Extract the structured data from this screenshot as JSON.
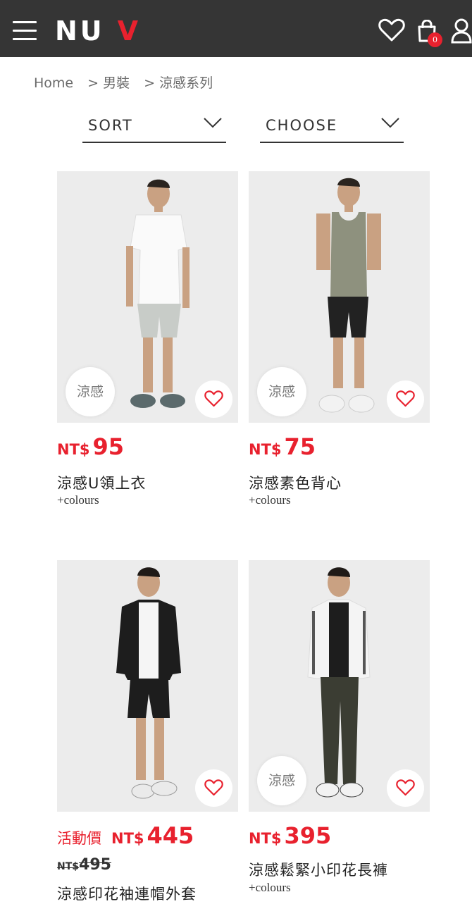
{
  "header": {
    "logo_left": "NU",
    "logo_right": "V",
    "cart_count": "0",
    "brand_color": "#e8212e",
    "bg_color": "#353535"
  },
  "breadcrumb": [
    "Home",
    "> 男裝",
    "> 涼感系列"
  ],
  "filters": {
    "sort_label": "SORT",
    "choose_label": "CHOOSE"
  },
  "products": [
    {
      "badge": "涼感",
      "currency": "NT$",
      "price": "95",
      "name": "涼感U領上衣",
      "colours": "+colours"
    },
    {
      "badge": "涼感",
      "currency": "NT$",
      "price": "75",
      "name": "涼感素色背心",
      "colours": "+colours"
    },
    {
      "promo": "活動價",
      "currency": "NT$",
      "price": "445",
      "old_currency": "NT$",
      "old_price": "495",
      "name": "涼感印花袖連帽外套"
    },
    {
      "badge": "涼感",
      "currency": "NT$",
      "price": "395",
      "name": "涼感鬆緊小印花長褲",
      "colours": "+colours"
    }
  ]
}
